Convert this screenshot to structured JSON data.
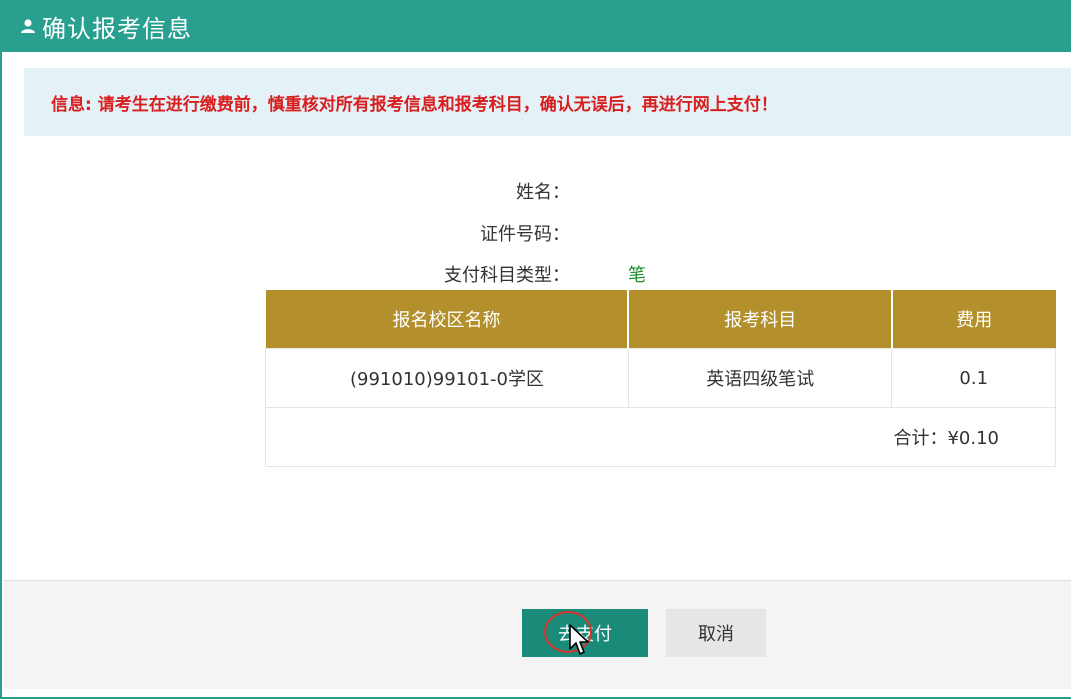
{
  "dialog": {
    "title": "确认报考信息",
    "title_icon": "user-icon",
    "header_color": "#29a08f"
  },
  "notice": {
    "text": "信息: 请考生在进行缴费前，慎重核对所有报考信息和报考科目，确认无误后，再进行网上支付！",
    "color": "#d81e1e"
  },
  "info": {
    "name_label": "姓名：",
    "name_value": "",
    "id_label": "证件号码：",
    "id_value": "",
    "subject_type_label": "支付科目类型：",
    "subject_type_value": "笔试"
  },
  "table": {
    "headers": [
      "报名校区名称",
      "报考科目",
      "费用"
    ],
    "rows": [
      [
        "(991010)99101-0学区",
        "英语四级笔试",
        "0.1"
      ]
    ],
    "total": "合计：¥0.10",
    "header_color": "#b3902c"
  },
  "buttons": {
    "pay": "去支付",
    "cancel": "取消",
    "pay_color": "#1a8a79"
  }
}
